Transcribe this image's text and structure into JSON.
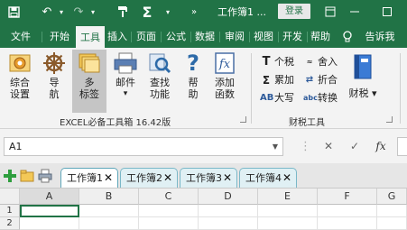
{
  "titlebar": {
    "doc_title": "工作簿1 ...",
    "login_label": "登录",
    "icons": [
      "save-icon",
      "undo-icon",
      "redo-icon",
      "format-painter-icon",
      "autosum-icon",
      "more-icon"
    ],
    "bg_color": "#217346"
  },
  "menu": {
    "tabs": [
      "文件",
      "开始",
      "工具",
      "插入",
      "页面",
      "公式",
      "数据",
      "审阅",
      "视图",
      "开发",
      "帮助"
    ],
    "active_tab": "工具",
    "tell_me": "告诉我"
  },
  "ribbon": {
    "group1": {
      "label": "EXCEL必备工具箱 16.42版",
      "buttons": [
        {
          "line1": "综合",
          "line2": "设置"
        },
        {
          "line1": "导",
          "line2": "航"
        },
        {
          "line1": "多",
          "line2": "标签"
        },
        {
          "line1": "邮件",
          "line2": "▾"
        },
        {
          "line1": "查找",
          "line2": "功能"
        },
        {
          "line1": "帮",
          "line2": "助"
        },
        {
          "line1": "添加",
          "line2": "函数"
        }
      ]
    },
    "group2": {
      "label": "财税工具",
      "small": [
        "个税",
        "累加",
        "大写",
        "舍入",
        "折合",
        "转换"
      ],
      "big": "财税 ▾"
    }
  },
  "formula": {
    "namebox": "A1",
    "cancel": "✕",
    "enter": "✓",
    "fx": "fx"
  },
  "workbooks": {
    "tabs": [
      "工作簿1",
      "工作簿2",
      "工作簿3",
      "工作簿4"
    ],
    "close": "✕"
  },
  "grid": {
    "columns": [
      "A",
      "B",
      "C",
      "D",
      "E",
      "F",
      "G"
    ],
    "rows": [
      "1",
      "2"
    ]
  },
  "colors": {
    "accent": "#217346",
    "tab_teal": "#7ab8c8"
  }
}
